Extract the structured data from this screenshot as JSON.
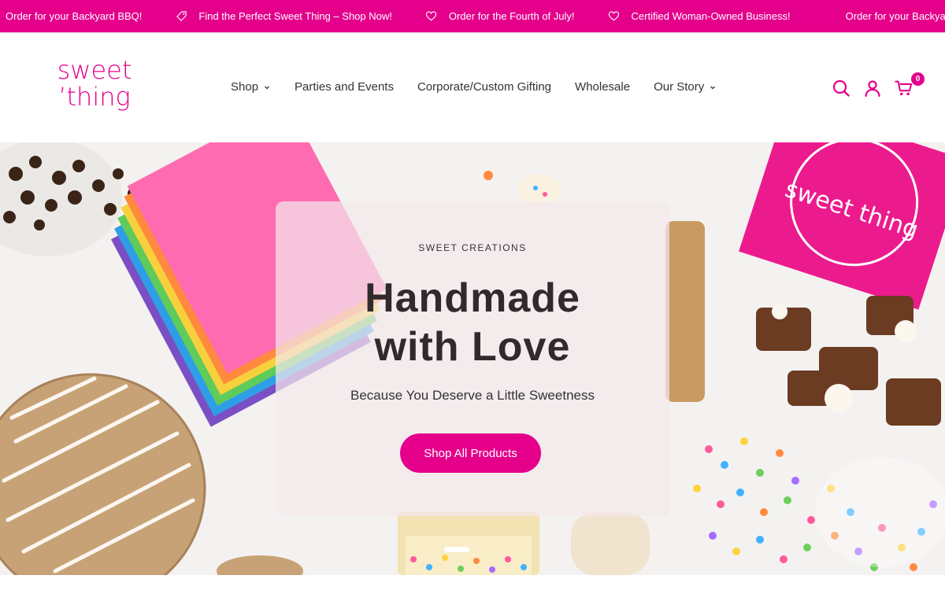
{
  "announcement": {
    "items": [
      {
        "text": "Order for your Backyard BBQ!",
        "icon": "tag-icon"
      },
      {
        "text": "Find the Perfect Sweet Thing – Shop Now!",
        "icon": "tag-icon"
      },
      {
        "text": "Order for the Fourth of July!",
        "icon": "heart-icon"
      },
      {
        "text": "Certified Woman-Owned Business!",
        "icon": "heart-icon"
      },
      {
        "text": "Order for your Backyard BBQ!",
        "icon": "tag-icon"
      }
    ]
  },
  "header": {
    "logo": {
      "line1": "sweet",
      "line2": "’thing"
    },
    "nav": [
      {
        "label": "Shop",
        "has_dropdown": true
      },
      {
        "label": "Parties and Events",
        "has_dropdown": false
      },
      {
        "label": "Corporate/Custom Gifting",
        "has_dropdown": false
      },
      {
        "label": "Wholesale",
        "has_dropdown": false
      },
      {
        "label": "Our Story",
        "has_dropdown": true
      }
    ],
    "actions": {
      "search_icon": "search-icon",
      "account_icon": "user-icon",
      "cart_icon": "cart-icon",
      "cart_count": "0"
    }
  },
  "hero": {
    "eyebrow": "SWEET CREATIONS",
    "headline_line1": "Handmade",
    "headline_line2": "with Love",
    "subheadline": "Because You Deserve a Little Sweetness",
    "cta_label": "Shop All Products",
    "package_text": "sweet thing"
  },
  "colors": {
    "brand": "#e5008c",
    "text": "#333333",
    "headline": "#302a2c"
  }
}
